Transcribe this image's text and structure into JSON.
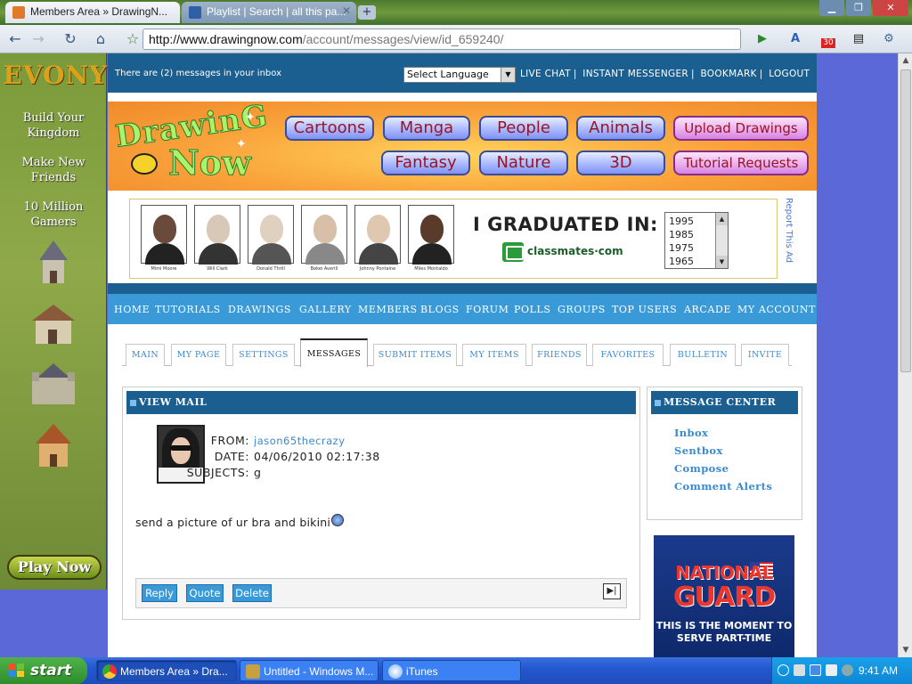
{
  "browser": {
    "tabs": [
      {
        "title": "Members Area » DrawingN...",
        "active": true
      },
      {
        "title": "Playlist | Search | all this pa...",
        "active": false
      }
    ],
    "new_tab_glyph": "+",
    "url_host": "http://www.drawingnow.com",
    "url_path": "/account/messages/view/id_659240/",
    "calendar_badge": "30"
  },
  "left_ad": {
    "logo": "EVONY",
    "lines": [
      "Build Your Kingdom",
      "Make New Friends",
      "10 Million Gamers"
    ],
    "cta": "Play Now"
  },
  "topbar": {
    "inbox_text": "There are (2) messages in your inbox",
    "language_select": "Select Language",
    "links": [
      "LIVE CHAT",
      "INSTANT MESSENGER",
      "BOOKMARK",
      "LOGOUT"
    ]
  },
  "site": {
    "brand_line1": "DrawinG",
    "brand_line2": "Now",
    "categories": [
      "Cartoons",
      "Manga",
      "People",
      "Animals",
      "Upload Drawings",
      "Fantasy",
      "Nature",
      "3D",
      "Tutorial Requests"
    ]
  },
  "classmates_ad": {
    "people": [
      "Mimi Moore",
      "Will Clark",
      "Donald Thrill",
      "Bekei Averill",
      "Johnny Pontaine",
      "Miles Montaldo"
    ],
    "headline": "I GRADUATED IN:",
    "brand": "classmates·com",
    "years": [
      "1995",
      "1985",
      "1975",
      "1965"
    ],
    "report": "Report This Ad"
  },
  "main_nav": [
    "HOME",
    "TUTORIALS",
    "DRAWINGS",
    "GALLERY",
    "MEMBERS",
    "BLOGS",
    "FORUM",
    "POLLS",
    "GROUPS",
    "TOP USERS",
    "ARCADE",
    "MY ACCOUNT"
  ],
  "account_tabs": [
    "MAIN",
    "MY PAGE",
    "SETTINGS",
    "MESSAGES",
    "SUBMIT ITEMS",
    "MY ITEMS",
    "FRIENDS",
    "FAVORITES",
    "BULLETIN",
    "INVITE"
  ],
  "active_account_tab": "MESSAGES",
  "view_mail": {
    "header": "VIEW MAIL",
    "from_label": "FROM:",
    "from": "jason65thecrazy",
    "date_label": "DATE:",
    "date": "04/06/2010 02:17:38",
    "subject_label": "SUBJECTS:",
    "subject": "g",
    "body": "send a picture of ur bra and bikini",
    "actions": [
      "Reply",
      "Quote",
      "Delete"
    ]
  },
  "message_center": {
    "header": "MESSAGE CENTER",
    "links": [
      "Inbox",
      "Sentbox",
      "Compose",
      "Comment Alerts"
    ]
  },
  "guard_ad": {
    "line1": "NATIONAL",
    "line2": "GUARD",
    "tagline": "THIS IS THE MOMENT TO SERVE PART-TIME"
  },
  "taskbar": {
    "start": "start",
    "tasks": [
      "Members Area » Dra...",
      "Untitled - Windows M...",
      "iTunes"
    ],
    "clock": "9:41 AM"
  }
}
